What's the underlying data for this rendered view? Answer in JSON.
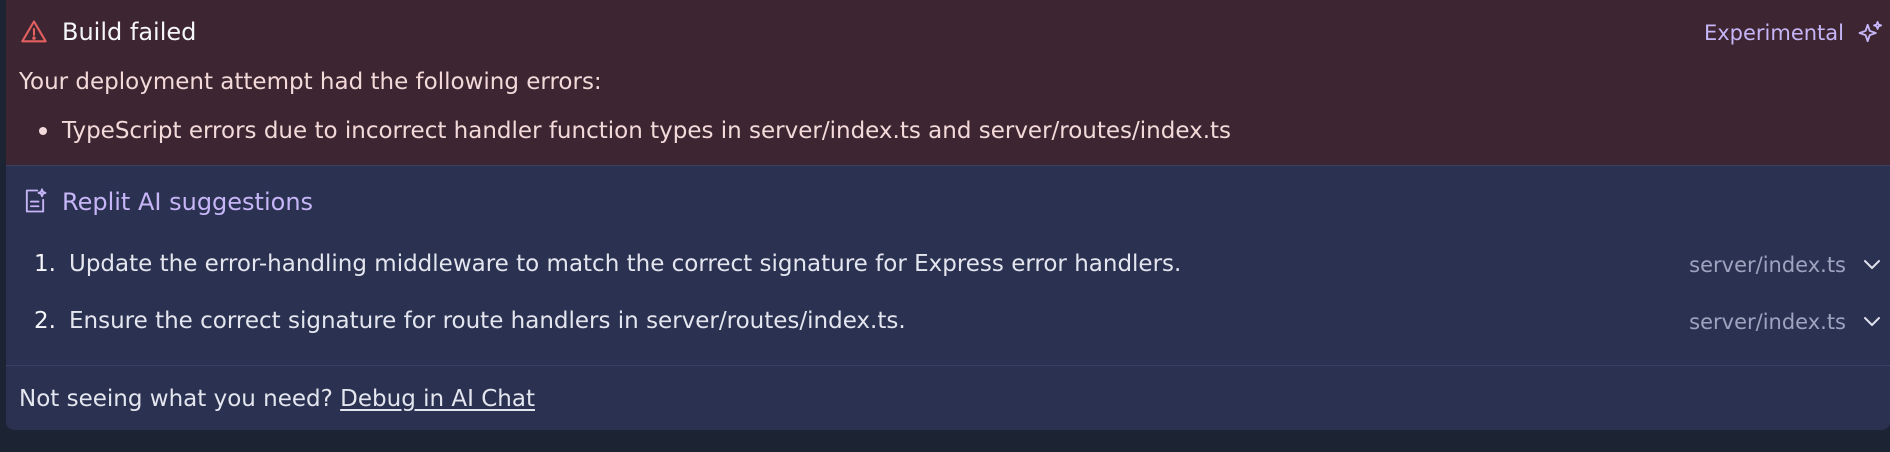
{
  "build": {
    "title": "Build failed",
    "badge": "Experimental",
    "intro": "Your deployment attempt had the following errors:",
    "errors": [
      "TypeScript errors due to incorrect handler function types in server/index.ts and server/routes/index.ts"
    ]
  },
  "suggestions": {
    "title": "Replit AI suggestions",
    "items": [
      {
        "number": "1.",
        "text": "Update the error-handling middleware to match the correct signature for Express error handlers.",
        "file": "server/index.ts"
      },
      {
        "number": "2.",
        "text": "Ensure the correct signature for route handlers in server/routes/index.ts.",
        "file": "server/index.ts"
      }
    ]
  },
  "footer": {
    "prompt": "Not seeing what you need?",
    "link": "Debug in AI Chat"
  },
  "icons": {
    "warning": "warning-triangle-icon",
    "sparkle": "sparkle-icon",
    "suggestions": "ai-document-icon",
    "expand": "chevron-down-icon"
  },
  "colors": {
    "error_bg": "#3d2631",
    "panel_bg": "#2b3150",
    "page_bg": "#1c2333",
    "warning_red": "#e36060",
    "accent_purple": "#c6b5f7"
  }
}
